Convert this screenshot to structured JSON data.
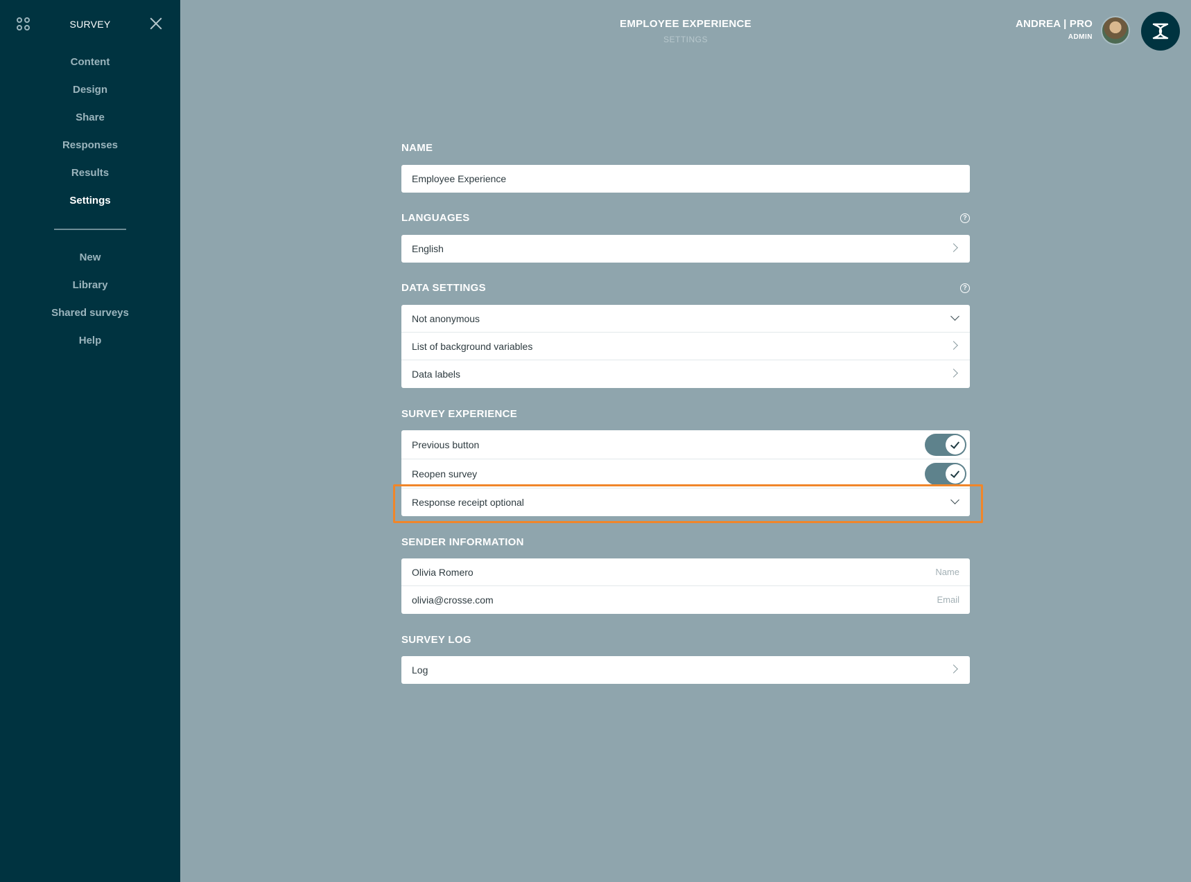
{
  "sidebar": {
    "title": "SURVEY",
    "items": [
      {
        "label": "Content"
      },
      {
        "label": "Design"
      },
      {
        "label": "Share"
      },
      {
        "label": "Responses"
      },
      {
        "label": "Results"
      },
      {
        "label": "Settings",
        "active": true
      }
    ],
    "secondary_items": [
      {
        "label": "New"
      },
      {
        "label": "Library"
      },
      {
        "label": "Shared surveys"
      },
      {
        "label": "Help"
      }
    ]
  },
  "header": {
    "title": "EMPLOYEE EXPERIENCE",
    "subtitle": "SETTINGS",
    "user_name": "ANDREA | PRO",
    "user_role": "ADMIN"
  },
  "sections": {
    "name": {
      "label": "NAME",
      "value": "Employee Experience"
    },
    "languages": {
      "label": "LANGUAGES",
      "value": "English"
    },
    "data_settings": {
      "label": "DATA SETTINGS",
      "anonymity": "Not anonymous",
      "background_variables": "List of background variables",
      "data_labels": "Data labels"
    },
    "survey_experience": {
      "label": "SURVEY EXPERIENCE",
      "previous_button": {
        "label": "Previous button",
        "enabled": true
      },
      "reopen_survey": {
        "label": "Reopen survey",
        "enabled": true
      },
      "response_receipt": "Response receipt optional"
    },
    "sender_information": {
      "label": "SENDER INFORMATION",
      "name_value": "Olivia Romero",
      "name_hint": "Name",
      "email_value": "olivia@crosse.com",
      "email_hint": "Email"
    },
    "survey_log": {
      "label": "SURVEY LOG",
      "log": "Log"
    }
  },
  "colors": {
    "sidebar_bg": "#003340",
    "main_bg": "#8fa5ad",
    "toggle_on": "#5e828c",
    "highlight": "#f0862a"
  },
  "icons": {
    "apps": "apps-grid-icon",
    "close": "close-icon",
    "help": "help-circle-icon",
    "chevron_right": "chevron-right-icon",
    "chevron_down": "chevron-down-icon",
    "logo": "brand-logo-icon"
  }
}
